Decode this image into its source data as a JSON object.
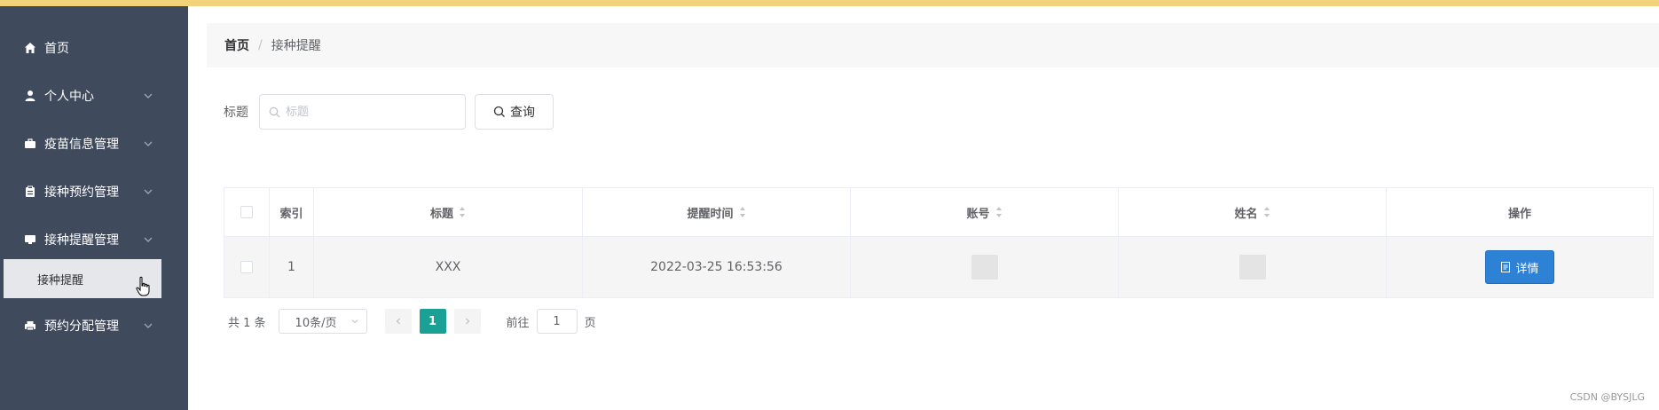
{
  "sidebar": {
    "items": [
      {
        "label": "首页",
        "icon": "home-icon"
      },
      {
        "label": "个人中心",
        "icon": "user-icon"
      },
      {
        "label": "疫苗信息管理",
        "icon": "briefcase-icon"
      },
      {
        "label": "接种预约管理",
        "icon": "clipboard-icon"
      },
      {
        "label": "接种提醒管理",
        "icon": "monitor-icon"
      },
      {
        "label": "预约分配管理",
        "icon": "printer-icon"
      }
    ],
    "active_sub": "接种提醒"
  },
  "breadcrumb": {
    "home": "首页",
    "separator": "/",
    "current": "接种提醒"
  },
  "search": {
    "label": "标题",
    "placeholder": "标题",
    "button": "查询"
  },
  "table": {
    "headers": [
      "索引",
      "标题",
      "提醒时间",
      "账号",
      "姓名",
      "操作"
    ],
    "rows": [
      {
        "index": "1",
        "title": "XXX",
        "time": "2022-03-25 16:53:56",
        "detail": "详情"
      }
    ]
  },
  "pagination": {
    "total": "共 1 条",
    "page_size": "10条/页",
    "current_page": "1",
    "goto_prefix": "前往",
    "goto_value": "1",
    "goto_suffix": "页"
  },
  "watermark": "CSDN @BYSJLG",
  "colors": {
    "sidebar_bg": "#404a5d",
    "accent": "#1aa094",
    "primary_button": "#2e82d6"
  }
}
